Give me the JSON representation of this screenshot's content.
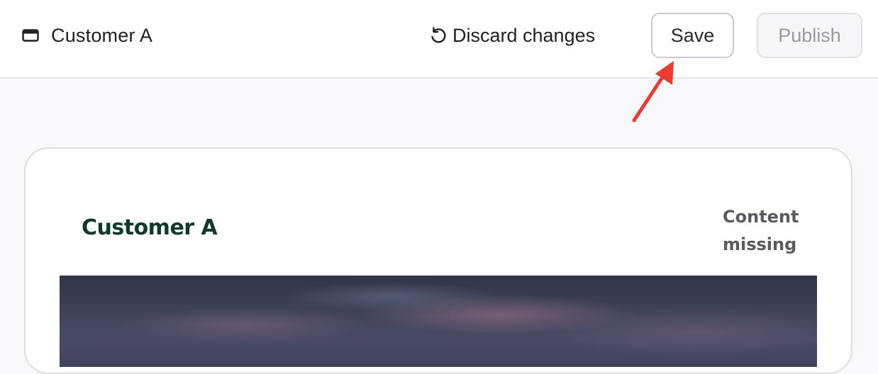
{
  "header": {
    "title": "Customer A",
    "title_icon": "browser-window-icon",
    "discard_label": "Discard changes",
    "discard_icon": "undo-icon",
    "save_label": "Save",
    "publish_label": "Publish"
  },
  "annotation": {
    "icon": "red-arrow-icon",
    "color": "#f03a2e"
  },
  "preview": {
    "title": "Customer A",
    "status_line1": "Content",
    "status_line2": "missing",
    "image": "hero-image"
  },
  "colors": {
    "accent_dark_green": "#0f3a2a",
    "background": "#f9f9fb"
  }
}
